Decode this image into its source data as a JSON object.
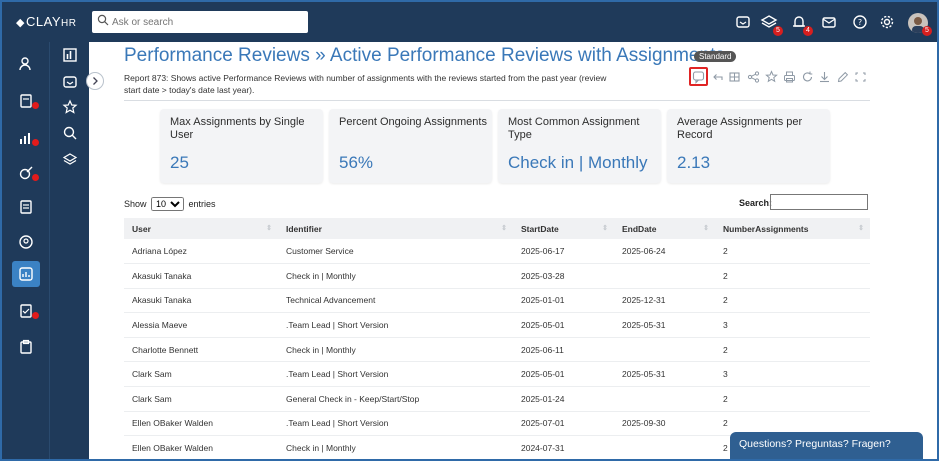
{
  "brand": {
    "name": "CLAY",
    "suffix": "HR"
  },
  "search": {
    "placeholder": "Ask or search"
  },
  "topbar_badges": {
    "layers": "5",
    "bell": "4",
    "avatar": "5"
  },
  "page": {
    "title": "Performance Reviews » Active Performance Reviews with Assignments",
    "badge": "Standard",
    "description": "Report 873: Shows active Performance Reviews with number of assignments with the reviews started from the past year (review start date > today's date last year)."
  },
  "cards": [
    {
      "label": "Max Assignments by Single User",
      "value": "25"
    },
    {
      "label": "Percent Ongoing Assignments",
      "value": "56%"
    },
    {
      "label": "Most Common Assignment Type",
      "value": "Check in | Monthly"
    },
    {
      "label": "Average Assignments per Record",
      "value": "2.13"
    }
  ],
  "table_controls": {
    "show_label": "Show",
    "entries_value": "10",
    "entries_label": "entries",
    "search_label": "Search:"
  },
  "table": {
    "headers": [
      "User",
      "Identifier",
      "StartDate",
      "EndDate",
      "NumberAssignments"
    ],
    "rows": [
      [
        "Adriana López",
        "Customer Service",
        "2025-06-17",
        "2025-06-24",
        "2"
      ],
      [
        "Akasuki Tanaka",
        "Check in | Monthly",
        "2025-03-28",
        "",
        "2"
      ],
      [
        "Akasuki Tanaka",
        "Technical Advancement",
        "2025-01-01",
        "2025-12-31",
        "2"
      ],
      [
        "Alessia Maeve",
        ".Team Lead | Short Version",
        "2025-05-01",
        "2025-05-31",
        "3"
      ],
      [
        "Charlotte Bennett",
        "Check in | Monthly",
        "2025-06-11",
        "",
        "2"
      ],
      [
        "Clark Sam",
        ".Team Lead | Short Version",
        "2025-05-01",
        "2025-05-31",
        "3"
      ],
      [
        "Clark Sam",
        "General Check in - Keep/Start/Stop",
        "2025-01-24",
        "",
        "2"
      ],
      [
        "Ellen OBaker Walden",
        ".Team Lead | Short Version",
        "2025-07-01",
        "2025-09-30",
        "2"
      ],
      [
        "Ellen OBaker Walden",
        "Check in | Monthly",
        "2024-07-31",
        "",
        "2"
      ]
    ]
  },
  "chat": {
    "label": "Questions? Preguntas? Fragen?"
  }
}
